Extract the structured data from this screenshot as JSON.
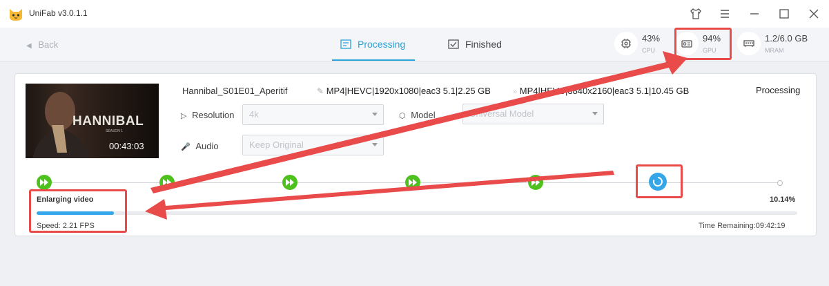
{
  "app": {
    "title": "UniFab v3.0.1.1",
    "icon": "cat-face-icon"
  },
  "window_controls": [
    "shirt-icon",
    "menu-icon",
    "minimize-icon",
    "maximize-icon",
    "close-icon"
  ],
  "nav": {
    "back_label": "Back",
    "tabs": [
      {
        "label": "Processing",
        "active": true,
        "icon": "list-icon"
      },
      {
        "label": "Finished",
        "active": false,
        "icon": "checkbox-icon"
      }
    ]
  },
  "stats": {
    "cpu": {
      "value": "43%",
      "label": "CPU"
    },
    "gpu": {
      "value": "94%",
      "label": "GPU"
    },
    "mram": {
      "value": "1.2/6.0 GB",
      "label": "MRAM"
    }
  },
  "task": {
    "thumbnail": {
      "title": "HANNIBAL",
      "subtitle": "SEASON 1",
      "duration": "00:43:03"
    },
    "filename": "Hannibal_S01E01_Aperitif",
    "source_info": "MP4|HEVC|1920x1080|eac3 5.1|2.25 GB",
    "output_info": "MP4|HEVC|3840x2160|eac3 5.1|10.45 GB",
    "status": "Processing",
    "resolution": {
      "label": "Resolution",
      "value": "4k"
    },
    "model": {
      "label": "Model",
      "value": "Universal Model"
    },
    "audio": {
      "label": "Audio",
      "value": "Keep Original"
    },
    "phase": "Enlarging video",
    "percent": "10.14%",
    "progress_fraction": 0.1014,
    "speed": "Speed: 2.21  FPS",
    "time_remaining": "Time Remaining:09:42:19"
  },
  "colors": {
    "accent": "#2aa3d8",
    "step_done": "#4fc11f",
    "highlight": "#e94b4b"
  }
}
